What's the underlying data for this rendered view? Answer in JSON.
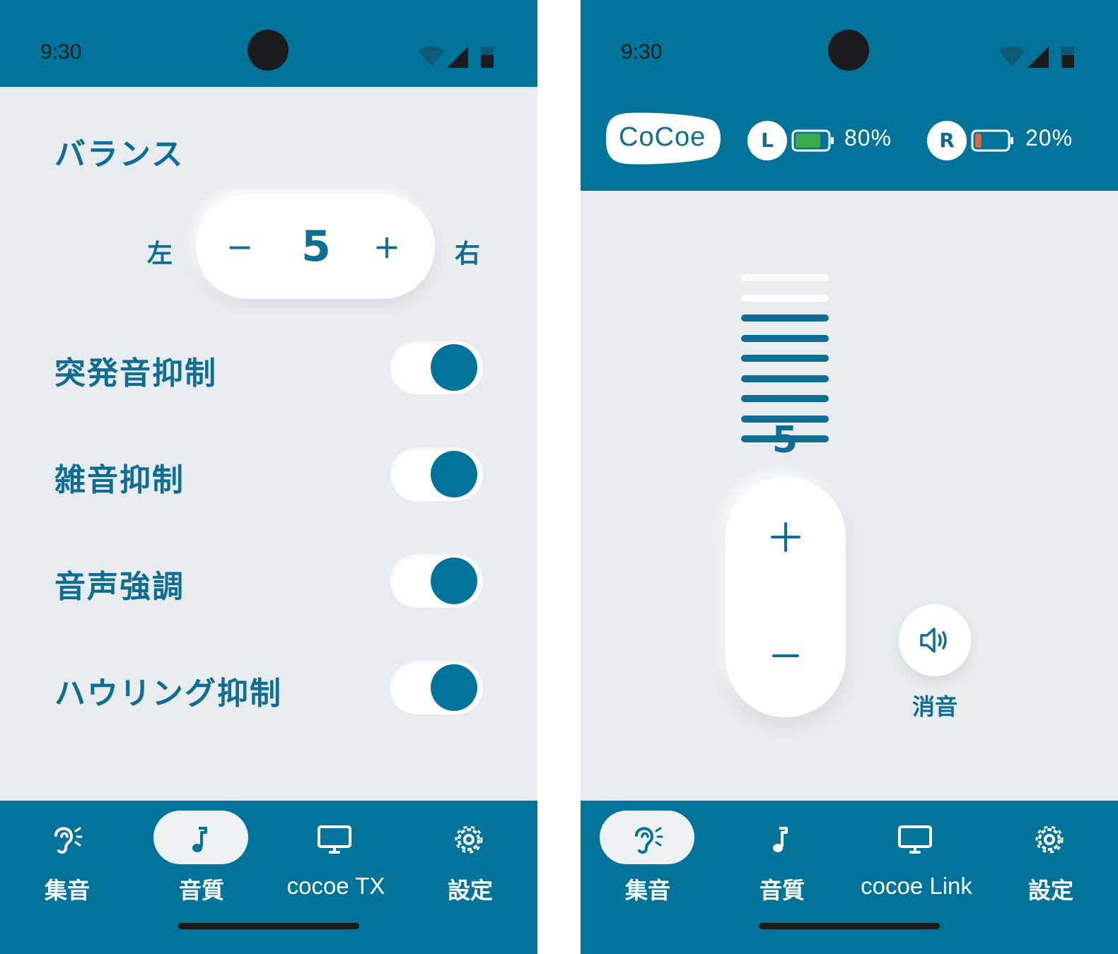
{
  "left_phone": {
    "status_time": "9:30",
    "balance": {
      "title": "バランス",
      "left_label": "左",
      "right_label": "右",
      "minus_label": "−",
      "plus_label": "+",
      "value": "5"
    },
    "toggles": [
      {
        "label": "突発音抑制",
        "on": true
      },
      {
        "label": "雑音抑制",
        "on": true
      },
      {
        "label": "音声強調",
        "on": true
      },
      {
        "label": "ハウリング抑制",
        "on": true
      }
    ],
    "nav": {
      "active": 1,
      "items": [
        {
          "label": "集音",
          "icon": "ear-icon"
        },
        {
          "label": "音質",
          "icon": "music-note-icon"
        },
        {
          "label": "cocoe TX",
          "icon": "monitor-icon"
        },
        {
          "label": "設定",
          "icon": "gear-icon"
        }
      ]
    }
  },
  "right_phone": {
    "status_time": "9:30",
    "logo_text": "CoCoe",
    "left_ear": {
      "label": "L",
      "battery_percent": "80%",
      "battery_fraction": 0.8,
      "battery_color": "#3aaa4a"
    },
    "right_ear": {
      "label": "R",
      "battery_percent": "20%",
      "battery_fraction": 0.2,
      "battery_color": "#e8643a"
    },
    "volume": {
      "value": "5",
      "level": 7,
      "max_level": 9
    },
    "mute_label": "消音",
    "nav": {
      "active": 0,
      "items": [
        {
          "label": "集音",
          "icon": "ear-icon"
        },
        {
          "label": "音質",
          "icon": "music-note-icon"
        },
        {
          "label": "cocoe Link",
          "icon": "monitor-icon"
        },
        {
          "label": "設定",
          "icon": "gear-icon"
        }
      ]
    }
  },
  "colors": {
    "primary": "#00739a",
    "text_primary": "#0d6d92",
    "background": "#e9ecef"
  }
}
